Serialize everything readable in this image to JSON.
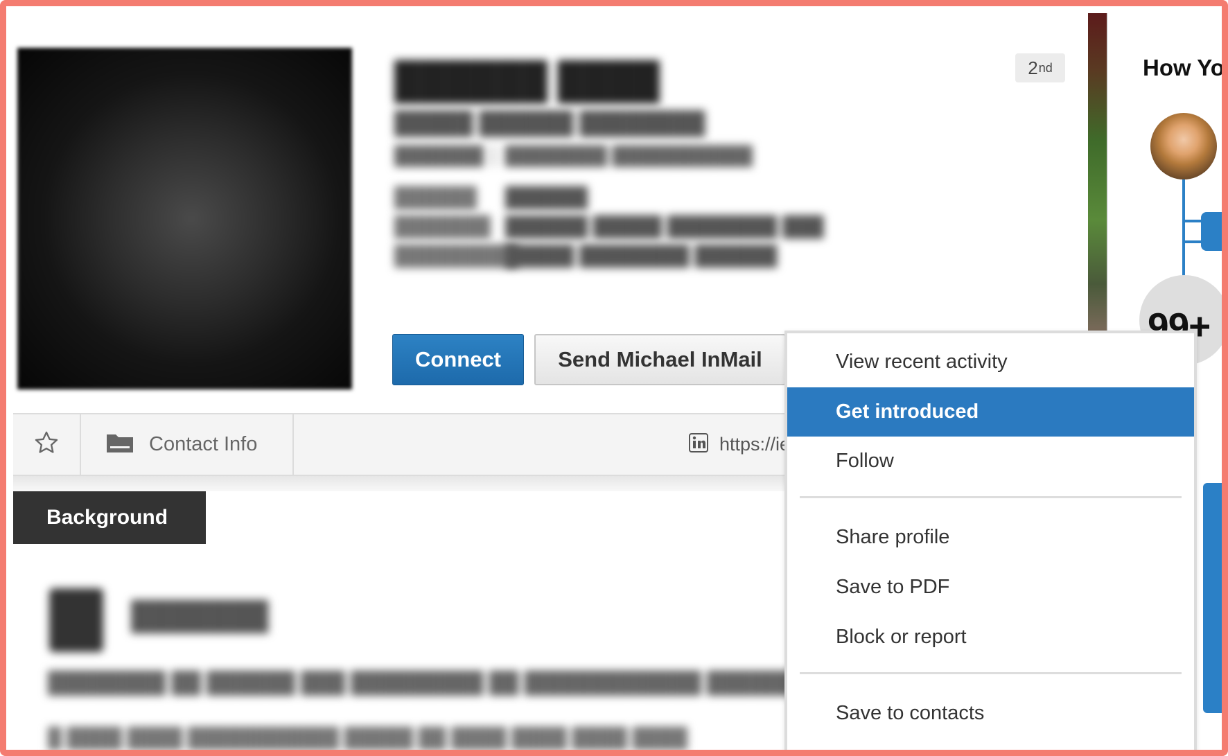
{
  "profile": {
    "connection_degree": "2",
    "connection_degree_suffix": "nd",
    "connect_label": "Connect",
    "inmail_label": "Send Michael InMail"
  },
  "info_bar": {
    "contact_info_label": "Contact Info",
    "public_url": "https://ie"
  },
  "background": {
    "tab_label": "Background"
  },
  "right_rail": {
    "title": "How Yo",
    "connection_count": "99+"
  },
  "dropdown": {
    "items": [
      {
        "label": "View recent activity",
        "active": false
      },
      {
        "label": "Get introduced",
        "active": true
      },
      {
        "label": "Follow",
        "active": false
      },
      {
        "label": "Share profile",
        "active": false
      },
      {
        "label": "Save to PDF",
        "active": false
      },
      {
        "label": "Block or report",
        "active": false
      },
      {
        "label": "Save to contacts",
        "active": false
      }
    ]
  },
  "colors": {
    "frame": "#f47c70",
    "primary": "#1d6aab",
    "menu_highlight": "#2b7ac0",
    "dark_tab": "#333333"
  },
  "icons": [
    "star-icon",
    "folder-icon",
    "linkedin-icon"
  ]
}
